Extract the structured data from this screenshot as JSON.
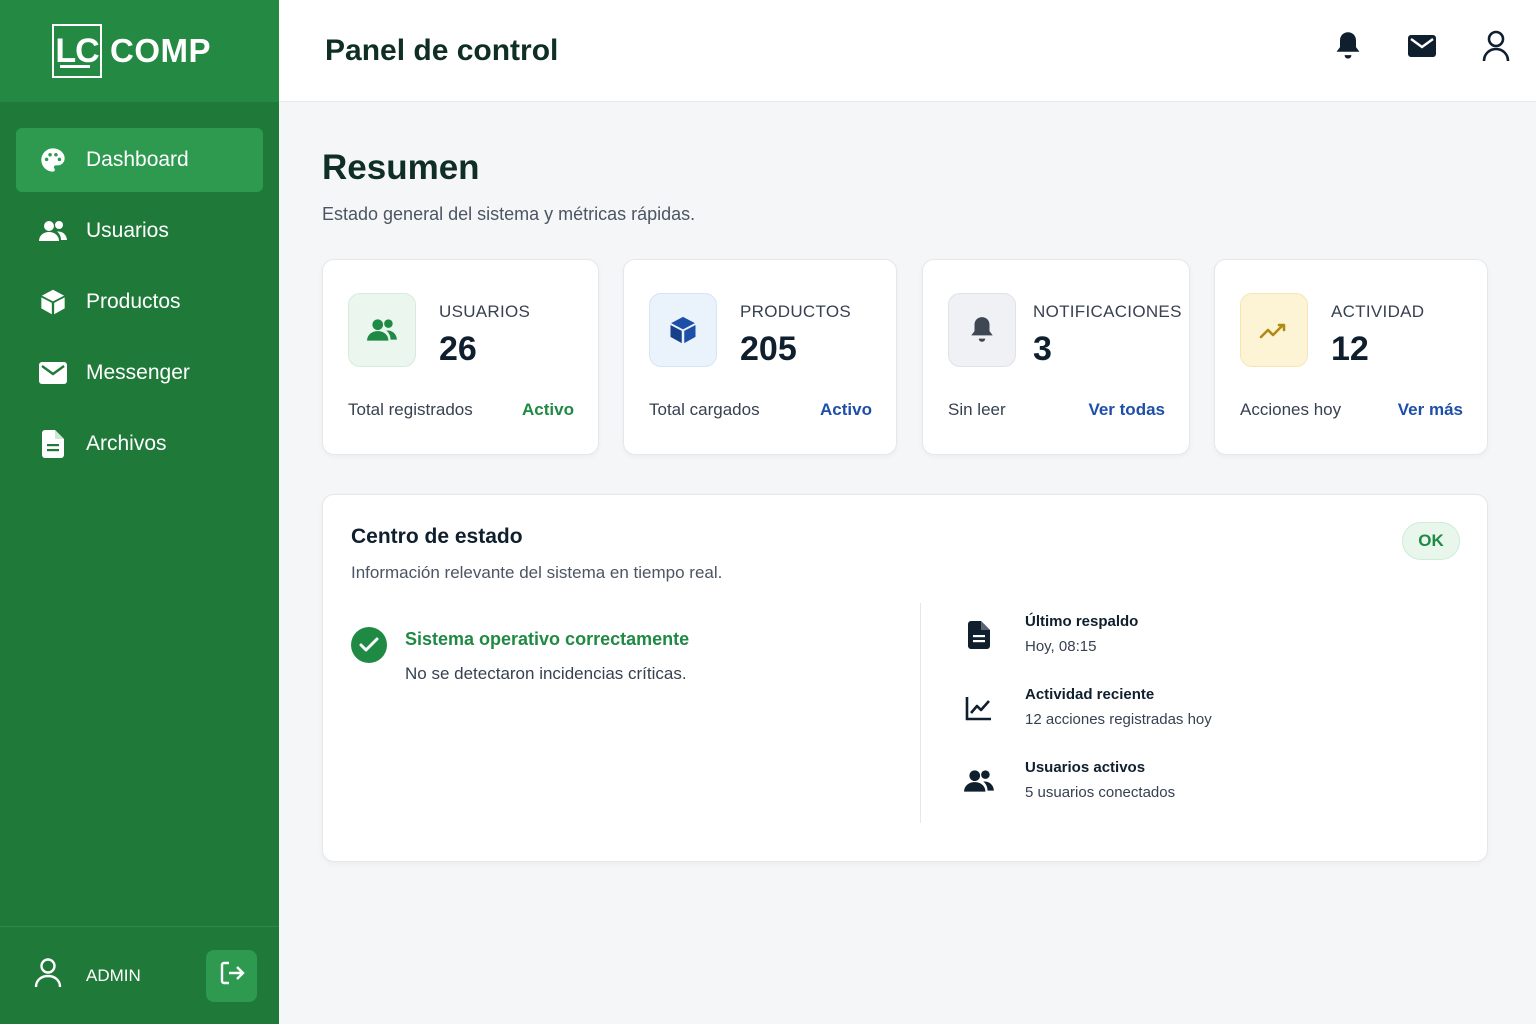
{
  "brand": {
    "mark": "LC",
    "name": "COMP"
  },
  "sidebar": {
    "items": [
      {
        "label": "Dashboard",
        "icon": "palette-icon",
        "active": true
      },
      {
        "label": "Usuarios",
        "icon": "users-icon"
      },
      {
        "label": "Productos",
        "icon": "box-icon"
      },
      {
        "label": "Messenger",
        "icon": "envelope-icon"
      },
      {
        "label": "Archivos",
        "icon": "file-icon"
      }
    ],
    "user": "ADMIN"
  },
  "header": {
    "title": "Panel de control"
  },
  "summary": {
    "title": "Resumen",
    "subtitle": "Estado general del sistema y métricas rápidas."
  },
  "cards": [
    {
      "label": "USUARIOS",
      "value": "26",
      "desc": "Total registrados",
      "link": "Activo",
      "icon": "users-icon",
      "accent": "#1f8a43"
    },
    {
      "label": "PRODUCTOS",
      "value": "205",
      "desc": "Total cargados",
      "link": "Activo",
      "icon": "cube-icon",
      "accent": "#1e4fa8"
    },
    {
      "label": "NOTIFICACIONES",
      "value": "3",
      "desc": "Sin leer",
      "link": "Ver todas",
      "icon": "bell-icon",
      "accent": "#1e4fa8"
    },
    {
      "label": "ACTIVIDAD",
      "value": "12",
      "desc": "Acciones hoy",
      "link": "Ver más",
      "icon": "trend-icon",
      "accent": "#1e4fa8"
    }
  ],
  "status": {
    "title": "Centro de estado",
    "subtitle": "Información relevante del sistema en tiempo real.",
    "badge": "OK",
    "main_title": "Sistema operativo correctamente",
    "main_desc": "No se detectaron incidencias críticas.",
    "items": [
      {
        "title": "Último respaldo",
        "desc": "Hoy, 08:15",
        "icon": "document-icon"
      },
      {
        "title": "Actividad reciente",
        "desc": "12 acciones registradas hoy",
        "icon": "chart-line-icon"
      },
      {
        "title": "Usuarios activos",
        "desc": "5 usuarios conectados",
        "icon": "users-icon"
      }
    ]
  },
  "colors": {
    "sidebar": "#1f7a3a",
    "brand_bar": "#248a43",
    "active_item": "#2e9a50",
    "success": "#1f8a43",
    "link_blue": "#1e4fa8"
  }
}
